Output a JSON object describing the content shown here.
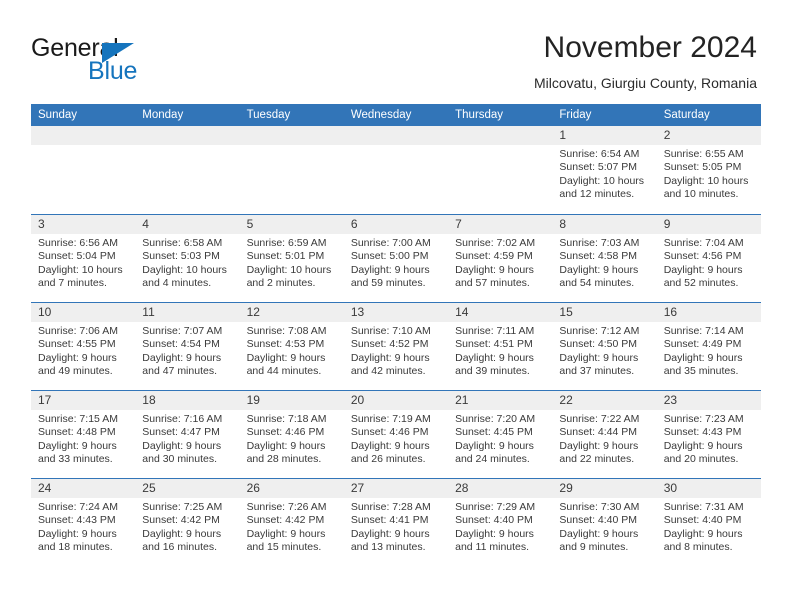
{
  "brand": {
    "name_part1": "General",
    "name_part2": "Blue",
    "accent_color": "#1574bd"
  },
  "header": {
    "title": "November 2024",
    "subtitle": "Milcovatu, Giurgiu County, Romania"
  },
  "theme": {
    "header_blue": "#3275b8",
    "day_head_gray": "#efefef",
    "text": "#3a3a3a"
  },
  "weekdays": [
    "Sunday",
    "Monday",
    "Tuesday",
    "Wednesday",
    "Thursday",
    "Friday",
    "Saturday"
  ],
  "weeks": [
    [
      {
        "day": "",
        "empty": true
      },
      {
        "day": "",
        "empty": true
      },
      {
        "day": "",
        "empty": true
      },
      {
        "day": "",
        "empty": true
      },
      {
        "day": "",
        "empty": true
      },
      {
        "day": "1",
        "sunrise": "Sunrise: 6:54 AM",
        "sunset": "Sunset: 5:07 PM",
        "daylight1": "Daylight: 10 hours",
        "daylight2": "and 12 minutes."
      },
      {
        "day": "2",
        "sunrise": "Sunrise: 6:55 AM",
        "sunset": "Sunset: 5:05 PM",
        "daylight1": "Daylight: 10 hours",
        "daylight2": "and 10 minutes."
      }
    ],
    [
      {
        "day": "3",
        "sunrise": "Sunrise: 6:56 AM",
        "sunset": "Sunset: 5:04 PM",
        "daylight1": "Daylight: 10 hours",
        "daylight2": "and 7 minutes."
      },
      {
        "day": "4",
        "sunrise": "Sunrise: 6:58 AM",
        "sunset": "Sunset: 5:03 PM",
        "daylight1": "Daylight: 10 hours",
        "daylight2": "and 4 minutes."
      },
      {
        "day": "5",
        "sunrise": "Sunrise: 6:59 AM",
        "sunset": "Sunset: 5:01 PM",
        "daylight1": "Daylight: 10 hours",
        "daylight2": "and 2 minutes."
      },
      {
        "day": "6",
        "sunrise": "Sunrise: 7:00 AM",
        "sunset": "Sunset: 5:00 PM",
        "daylight1": "Daylight: 9 hours",
        "daylight2": "and 59 minutes."
      },
      {
        "day": "7",
        "sunrise": "Sunrise: 7:02 AM",
        "sunset": "Sunset: 4:59 PM",
        "daylight1": "Daylight: 9 hours",
        "daylight2": "and 57 minutes."
      },
      {
        "day": "8",
        "sunrise": "Sunrise: 7:03 AM",
        "sunset": "Sunset: 4:58 PM",
        "daylight1": "Daylight: 9 hours",
        "daylight2": "and 54 minutes."
      },
      {
        "day": "9",
        "sunrise": "Sunrise: 7:04 AM",
        "sunset": "Sunset: 4:56 PM",
        "daylight1": "Daylight: 9 hours",
        "daylight2": "and 52 minutes."
      }
    ],
    [
      {
        "day": "10",
        "sunrise": "Sunrise: 7:06 AM",
        "sunset": "Sunset: 4:55 PM",
        "daylight1": "Daylight: 9 hours",
        "daylight2": "and 49 minutes."
      },
      {
        "day": "11",
        "sunrise": "Sunrise: 7:07 AM",
        "sunset": "Sunset: 4:54 PM",
        "daylight1": "Daylight: 9 hours",
        "daylight2": "and 47 minutes."
      },
      {
        "day": "12",
        "sunrise": "Sunrise: 7:08 AM",
        "sunset": "Sunset: 4:53 PM",
        "daylight1": "Daylight: 9 hours",
        "daylight2": "and 44 minutes."
      },
      {
        "day": "13",
        "sunrise": "Sunrise: 7:10 AM",
        "sunset": "Sunset: 4:52 PM",
        "daylight1": "Daylight: 9 hours",
        "daylight2": "and 42 minutes."
      },
      {
        "day": "14",
        "sunrise": "Sunrise: 7:11 AM",
        "sunset": "Sunset: 4:51 PM",
        "daylight1": "Daylight: 9 hours",
        "daylight2": "and 39 minutes."
      },
      {
        "day": "15",
        "sunrise": "Sunrise: 7:12 AM",
        "sunset": "Sunset: 4:50 PM",
        "daylight1": "Daylight: 9 hours",
        "daylight2": "and 37 minutes."
      },
      {
        "day": "16",
        "sunrise": "Sunrise: 7:14 AM",
        "sunset": "Sunset: 4:49 PM",
        "daylight1": "Daylight: 9 hours",
        "daylight2": "and 35 minutes."
      }
    ],
    [
      {
        "day": "17",
        "sunrise": "Sunrise: 7:15 AM",
        "sunset": "Sunset: 4:48 PM",
        "daylight1": "Daylight: 9 hours",
        "daylight2": "and 33 minutes."
      },
      {
        "day": "18",
        "sunrise": "Sunrise: 7:16 AM",
        "sunset": "Sunset: 4:47 PM",
        "daylight1": "Daylight: 9 hours",
        "daylight2": "and 30 minutes."
      },
      {
        "day": "19",
        "sunrise": "Sunrise: 7:18 AM",
        "sunset": "Sunset: 4:46 PM",
        "daylight1": "Daylight: 9 hours",
        "daylight2": "and 28 minutes."
      },
      {
        "day": "20",
        "sunrise": "Sunrise: 7:19 AM",
        "sunset": "Sunset: 4:46 PM",
        "daylight1": "Daylight: 9 hours",
        "daylight2": "and 26 minutes."
      },
      {
        "day": "21",
        "sunrise": "Sunrise: 7:20 AM",
        "sunset": "Sunset: 4:45 PM",
        "daylight1": "Daylight: 9 hours",
        "daylight2": "and 24 minutes."
      },
      {
        "day": "22",
        "sunrise": "Sunrise: 7:22 AM",
        "sunset": "Sunset: 4:44 PM",
        "daylight1": "Daylight: 9 hours",
        "daylight2": "and 22 minutes."
      },
      {
        "day": "23",
        "sunrise": "Sunrise: 7:23 AM",
        "sunset": "Sunset: 4:43 PM",
        "daylight1": "Daylight: 9 hours",
        "daylight2": "and 20 minutes."
      }
    ],
    [
      {
        "day": "24",
        "sunrise": "Sunrise: 7:24 AM",
        "sunset": "Sunset: 4:43 PM",
        "daylight1": "Daylight: 9 hours",
        "daylight2": "and 18 minutes."
      },
      {
        "day": "25",
        "sunrise": "Sunrise: 7:25 AM",
        "sunset": "Sunset: 4:42 PM",
        "daylight1": "Daylight: 9 hours",
        "daylight2": "and 16 minutes."
      },
      {
        "day": "26",
        "sunrise": "Sunrise: 7:26 AM",
        "sunset": "Sunset: 4:42 PM",
        "daylight1": "Daylight: 9 hours",
        "daylight2": "and 15 minutes."
      },
      {
        "day": "27",
        "sunrise": "Sunrise: 7:28 AM",
        "sunset": "Sunset: 4:41 PM",
        "daylight1": "Daylight: 9 hours",
        "daylight2": "and 13 minutes."
      },
      {
        "day": "28",
        "sunrise": "Sunrise: 7:29 AM",
        "sunset": "Sunset: 4:40 PM",
        "daylight1": "Daylight: 9 hours",
        "daylight2": "and 11 minutes."
      },
      {
        "day": "29",
        "sunrise": "Sunrise: 7:30 AM",
        "sunset": "Sunset: 4:40 PM",
        "daylight1": "Daylight: 9 hours",
        "daylight2": "and 9 minutes."
      },
      {
        "day": "30",
        "sunrise": "Sunrise: 7:31 AM",
        "sunset": "Sunset: 4:40 PM",
        "daylight1": "Daylight: 9 hours",
        "daylight2": "and 8 minutes."
      }
    ]
  ]
}
